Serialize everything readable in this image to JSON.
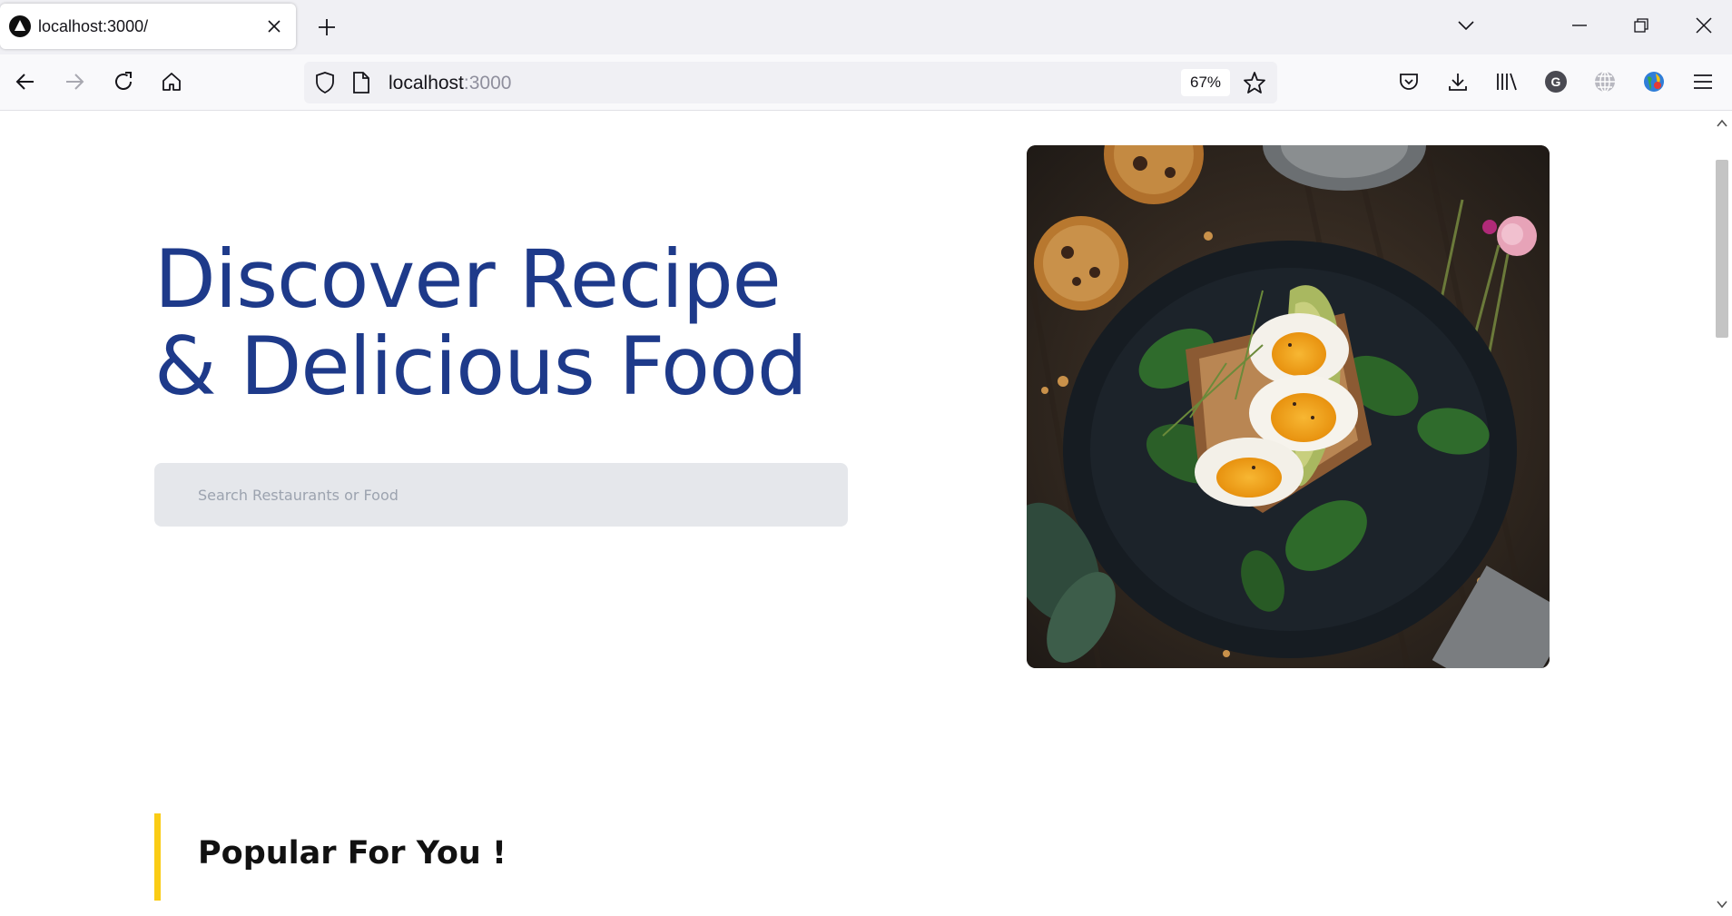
{
  "browser": {
    "tab_title": "localhost:3000/",
    "url_host": "localhost",
    "url_port": ":3000",
    "zoom": "67%"
  },
  "hero": {
    "title_line1": "Discover Recipe",
    "title_line2": "& Delicious Food",
    "search_placeholder": "Search Restaurants or Food",
    "image_alt": "Toast with spinach, avocado and halved boiled eggs on a dark plate"
  },
  "popular": {
    "title": "Popular For You !"
  },
  "colors": {
    "title_blue": "#1e3a8a",
    "accent_yellow": "#facc15",
    "search_bg": "#e5e7eb"
  }
}
